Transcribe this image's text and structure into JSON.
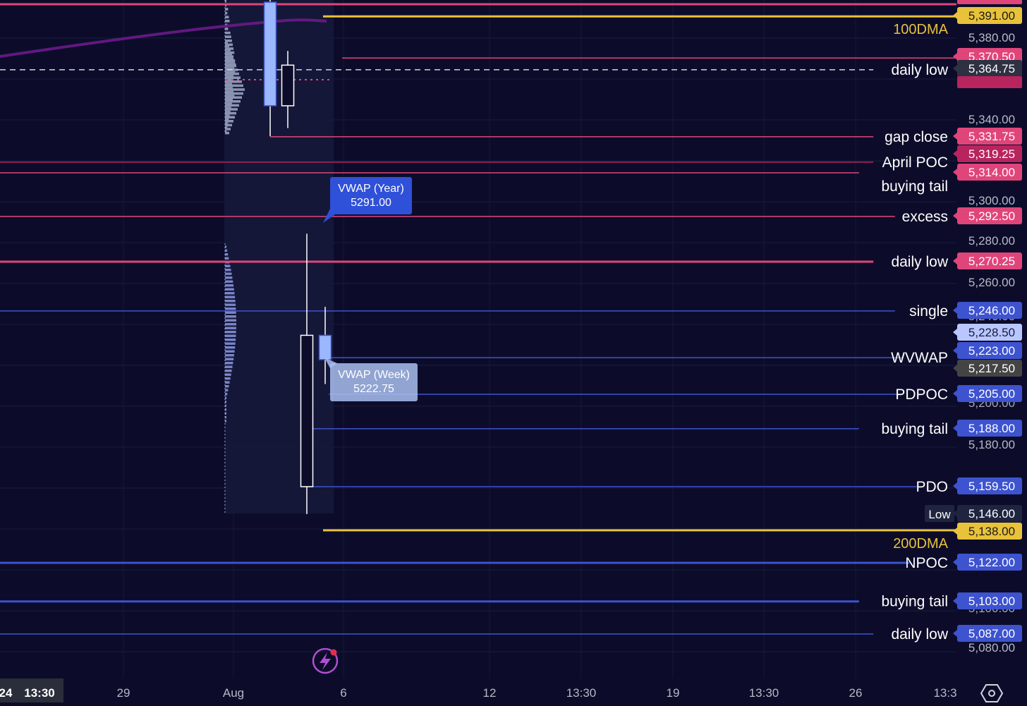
{
  "chart_data": {
    "type": "candlestick",
    "y_axis_ticks": [
      "5,380.00",
      "5,340.00",
      "5,300.00",
      "5,280.00",
      "5,260.00",
      "5,180.00",
      "5,080.00"
    ],
    "x_axis_ticks": [
      "24",
      "13:30",
      "29",
      "Aug",
      "6",
      "12",
      "13:30",
      "19",
      "13:30",
      "26",
      "13:3"
    ],
    "candles": [
      {
        "date": "Aug 1",
        "open": 5398.0,
        "high": 5402.0,
        "low": 5332.0,
        "close": 5347.0,
        "color": "#9bb8ff"
      },
      {
        "date": "Aug 2",
        "open": 5347.0,
        "high": 5374.0,
        "low": 5336.0,
        "close": 5367.0,
        "color": "#ffffff"
      },
      {
        "date": "Aug 5",
        "open": 5159.5,
        "high": 5284.0,
        "low": 5146.0,
        "close": 5234.0,
        "color": "#ffffff"
      },
      {
        "date": "Aug 6",
        "open": 5234.0,
        "high": 5248.0,
        "low": 5210.0,
        "close": 5222.0,
        "color": "#9bb8ff"
      }
    ],
    "levels": [
      {
        "label": "100DMA",
        "price": "5,391.00",
        "value": 5391.0,
        "color": "#e8c23a",
        "label_color": "#e8c23a",
        "tag_color": "#e8c23a",
        "tag_text_color": "#1a1a1a"
      },
      {
        "label": "",
        "price": "5,370.50",
        "value": 5370.5,
        "color": "#e0457a",
        "label_color": "#ffffff",
        "tag_color": "#e0457a",
        "tag_text_color": "#ffffff"
      },
      {
        "label": "daily low",
        "price": "5,364.75",
        "value": 5364.75,
        "color": "#cfd3dc",
        "label_color": "#ffffff",
        "tag_color": "#2d3142",
        "tag_text_color": "#ffffff",
        "dashed": true
      },
      {
        "label": "gap close",
        "price": "5,331.75",
        "value": 5331.75,
        "color": "#e0457a",
        "label_color": "#ffffff",
        "tag_color": "#e0457a",
        "tag_text_color": "#ffffff"
      },
      {
        "label": "April POC",
        "price": "5,319.25",
        "value": 5319.25,
        "color": "#b8245e",
        "label_color": "#ffffff",
        "tag_color": "#b8245e",
        "tag_text_color": "#ffffff"
      },
      {
        "label": "buying tail",
        "price": "5,314.00",
        "value": 5314.0,
        "color": "#e0457a",
        "label_color": "#ffffff",
        "tag_color": "#e0457a",
        "tag_text_color": "#ffffff"
      },
      {
        "label": "excess",
        "price": "5,292.50",
        "value": 5292.5,
        "color": "#e0457a",
        "label_color": "#ffffff",
        "tag_color": "#e0457a",
        "tag_text_color": "#ffffff"
      },
      {
        "label": "daily low",
        "price": "5,270.25",
        "value": 5270.25,
        "color": "#e0457a",
        "label_color": "#ffffff",
        "tag_color": "#e0457a",
        "tag_text_color": "#ffffff"
      },
      {
        "label": "single",
        "price": "5,246.00",
        "value": 5246.0,
        "color": "#3d53cf",
        "label_color": "#ffffff",
        "tag_color": "#3d53cf",
        "tag_text_color": "#ffffff"
      },
      {
        "label": "",
        "price": "5,228.50",
        "value": 5228.5,
        "color": "#b8c8ff",
        "label_color": "#ffffff",
        "tag_color": "#b8c8ff",
        "tag_text_color": "#1a1a3a"
      },
      {
        "label": "WVWAP",
        "price": "5,223.00",
        "value": 5223.0,
        "color": "#3d53cf",
        "label_color": "#ffffff",
        "tag_color": "#3d53cf",
        "tag_text_color": "#ffffff"
      },
      {
        "label": "",
        "price": "5,217.50",
        "value": 5217.5,
        "color": "#444444",
        "label_color": "#ffffff",
        "tag_color": "#444444",
        "tag_text_color": "#ffffff"
      },
      {
        "label": "PDPOC",
        "price": "5,205.00",
        "value": 5205.0,
        "color": "#3d53cf",
        "label_color": "#ffffff",
        "tag_color": "#3d53cf",
        "tag_text_color": "#ffffff"
      },
      {
        "label": "buying tail",
        "price": "5,188.00",
        "value": 5188.0,
        "color": "#3d53cf",
        "label_color": "#ffffff",
        "tag_color": "#3d53cf",
        "tag_text_color": "#ffffff"
      },
      {
        "label": "PDO",
        "price": "5,159.50",
        "value": 5159.5,
        "color": "#3d53cf",
        "label_color": "#ffffff",
        "tag_color": "#3d53cf",
        "tag_text_color": "#ffffff"
      },
      {
        "label": "Low",
        "price": "5,146.00",
        "value": 5146.0,
        "color": "",
        "label_color": "#ffffff",
        "tag_color": "#1f2540",
        "tag_text_color": "#ffffff",
        "label_boxed": true
      },
      {
        "label": "200DMA",
        "price": "5,138.00",
        "value": 5138.0,
        "color": "#e8c23a",
        "label_color": "#e8c23a",
        "tag_color": "#e8c23a",
        "tag_text_color": "#1a1a1a"
      },
      {
        "label": "NPOC",
        "price": "5,122.00",
        "value": 5122.0,
        "color": "#3d53cf",
        "label_color": "#ffffff",
        "tag_color": "#3d53cf",
        "tag_text_color": "#ffffff"
      },
      {
        "label": "buying tail",
        "price": "5,103.00",
        "value": 5103.0,
        "color": "#3d53cf",
        "label_color": "#ffffff",
        "tag_color": "#3d53cf",
        "tag_text_color": "#ffffff"
      },
      {
        "label": "daily low",
        "price": "5,087.00",
        "value": 5087.0,
        "color": "#3d53cf",
        "label_color": "#ffffff",
        "tag_color": "#3d53cf",
        "tag_text_color": "#ffffff"
      }
    ],
    "callouts": [
      {
        "title": "VWAP (Year)",
        "value": "5291.00",
        "price": 5291.0,
        "bg": "#2f50d8",
        "text_color": "#ffffff"
      },
      {
        "title": "VWAP (Week)",
        "value": "5222.75",
        "price": 5222.75,
        "bg": "#a9bff0",
        "text_color": "#ffffff"
      }
    ],
    "moving_average": {
      "name": "",
      "color": "#6a1a8a"
    },
    "grid": true
  },
  "toolbar": {
    "settings_icon": "settings-hexagon-icon",
    "alert_icon": "lightning-alert-icon"
  }
}
